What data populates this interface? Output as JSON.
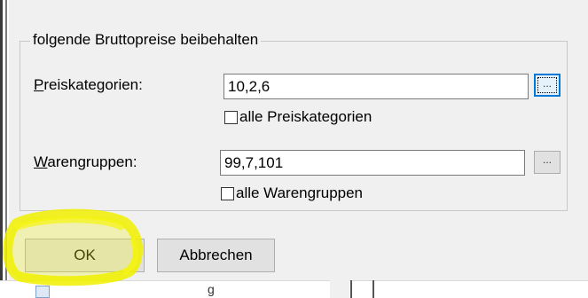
{
  "dialog": {
    "group_title": "folgende Bruttopreise beibehalten",
    "price_categories": {
      "label_accel": "P",
      "label_rest": "reiskategorien:",
      "value": "10,2,6",
      "browse_label": "...",
      "all_checkbox_label": "alle Preiskategorien",
      "all_checked": false
    },
    "product_groups": {
      "label_accel": "W",
      "label_rest": "arengruppen:",
      "value": "99,7,101",
      "browse_label": "...",
      "all_checkbox_label": "alle Warengruppen",
      "all_checked": false
    },
    "buttons": {
      "ok_label": "OK",
      "cancel_label": "Abbrechen"
    }
  },
  "underlying": {
    "partial_text": "g"
  },
  "colors": {
    "highlight": "#f2f214",
    "focus_border": "#0078d7",
    "dialog_bg": "#f0f0f0"
  }
}
